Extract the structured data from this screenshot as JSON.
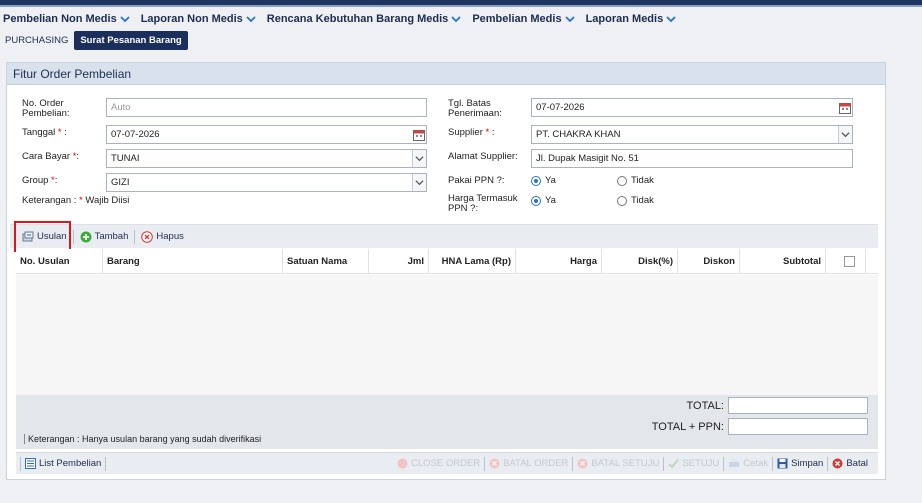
{
  "nav": {
    "items": [
      {
        "label": "Pembelian Non Medis"
      },
      {
        "label": "Laporan Non Medis"
      },
      {
        "label": "Rencana Kebutuhan Barang Medis"
      },
      {
        "label": "Pembelian Medis"
      },
      {
        "label": "Laporan Medis"
      }
    ]
  },
  "breadcrumb": {
    "section": "PURCHASING",
    "current": "Surat Pesanan Barang"
  },
  "panel": {
    "title": "Fitur Order Pembelian"
  },
  "form": {
    "no_order_label": "No. Order Pembelian:",
    "no_order_placeholder": "Auto",
    "tanggal_label": "Tanggal",
    "tanggal_value": "07-07-2026",
    "cara_bayar_label": "Cara Bayar",
    "cara_bayar_value": "TUNAI",
    "group_label": "Group",
    "group_value": "GIZI",
    "keterangan_label": "Keterangan :",
    "keterangan_text": "Wajib Diisi",
    "tgl_batas_label": "Tgl. Batas Penerimaan:",
    "tgl_batas_value": "07-07-2026",
    "supplier_label": "Supplier",
    "supplier_value": "PT. CHAKRA KHAN",
    "alamat_label": "Alamat Supplier:",
    "alamat_value": "Jl. Dupak Masigit No. 51",
    "ppn_label": "Pakai PPN ?:",
    "harga_ppn_label": "Harga Termasuk PPN ?:",
    "ya": "Ya",
    "tidak": "Tidak",
    "req_mark": "*",
    "colon": ":",
    "ppn_selected": "Ya",
    "harga_ppn_selected": "Ya"
  },
  "toolbar": {
    "usulan": "Usulan",
    "tambah": "Tambah",
    "hapus": "Hapus"
  },
  "table": {
    "columns": [
      "No. Usulan",
      "Barang",
      "Satuan Nama",
      "Jml",
      "HNA Lama (Rp)",
      "Harga",
      "Disk(%)",
      "Diskon",
      "Subtotal"
    ],
    "rows": []
  },
  "totals": {
    "total_label": "TOTAL:",
    "total_ppn_label": "TOTAL + PPN:",
    "total_value": "",
    "total_ppn_value": ""
  },
  "footer_note": "Keterangan : Hanya usulan barang yang sudah diverifikasi",
  "bottom": {
    "list": "List Pembelian",
    "close_order": "CLOSE ORDER",
    "batal_order": "BATAL ORDER",
    "batal_setuju": "BATAL SETUJU",
    "setuju": "SETUJU",
    "cetak": "Cetak",
    "simpan": "Simpan",
    "batal": "Batal"
  },
  "colors": {
    "navy": "#1b2f5c",
    "accent_red": "#d41b1b",
    "panel_head": "#d8e1ec"
  }
}
